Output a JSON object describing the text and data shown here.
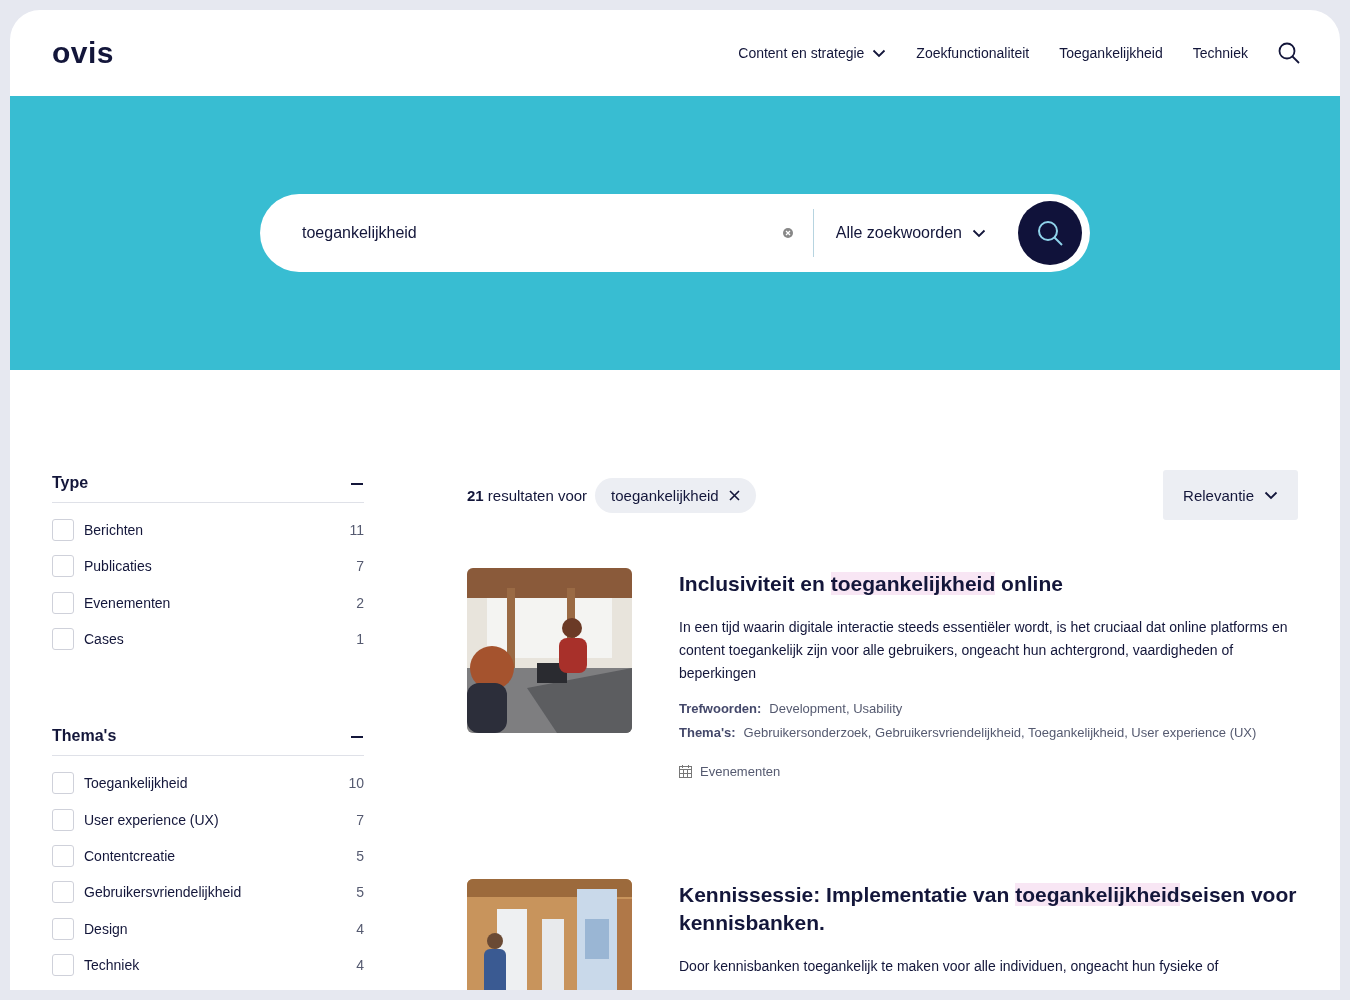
{
  "header": {
    "logo": "ovis",
    "nav": [
      {
        "label": "Content en strategie",
        "kind": "dropdown"
      },
      {
        "label": "Zoekfunctionaliteit",
        "kind": "link"
      },
      {
        "label": "Toegankelijkheid",
        "kind": "link"
      },
      {
        "label": "Techniek",
        "kind": "link"
      }
    ]
  },
  "search": {
    "value": "toegankelijkheid",
    "mode": "Alle zoekwoorden"
  },
  "filters": [
    {
      "title": "Type",
      "expanded": true,
      "options": [
        {
          "label": "Berichten",
          "count": "11",
          "checked": false
        },
        {
          "label": "Publicaties",
          "count": "7",
          "checked": false
        },
        {
          "label": "Evenementen",
          "count": "2",
          "checked": false
        },
        {
          "label": "Cases",
          "count": "1",
          "checked": false
        }
      ]
    },
    {
      "title": "Thema's",
      "expanded": true,
      "options": [
        {
          "label": "Toegankelijkheid",
          "count": "10",
          "checked": false
        },
        {
          "label": "User experience (UX)",
          "count": "7",
          "checked": false
        },
        {
          "label": "Contentcreatie",
          "count": "5",
          "checked": false
        },
        {
          "label": "Gebruikersvriendelijkheid",
          "count": "5",
          "checked": false
        },
        {
          "label": "Design",
          "count": "4",
          "checked": false
        },
        {
          "label": "Techniek",
          "count": "4",
          "checked": false
        }
      ]
    }
  ],
  "results_header": {
    "count": "21",
    "text": "resultaten voor",
    "chip": "toegankelijkheid",
    "sort": "Relevantie"
  },
  "results": [
    {
      "kind": "picture",
      "title_parts": [
        {
          "text": "Inclusiviteit en ",
          "highlighted": false
        },
        {
          "text": "toegankelijkheid",
          "highlighted": true
        },
        {
          "text": " online",
          "highlighted": false
        }
      ],
      "description": "In een tijd waarin digitale interactie steeds essentiëler wordt, is het cruciaal dat online platforms en content toegankelijk zijn voor alle gebruikers, ongeacht hun achtergrond, vaardigheden of beperkingen",
      "meta": [
        {
          "label": "Trefwoorden:",
          "value": "Development, Usability"
        },
        {
          "label": "Thema's:",
          "value": "Gebruikersonderzoek, Gebruikersvriendelijkheid, Toegankelijkheid, User experience (UX)"
        }
      ],
      "type": "Evenementen"
    },
    {
      "kind": "picture",
      "title_parts": [
        {
          "text": "Kennissessie: Implementatie van ",
          "highlighted": false
        },
        {
          "text": "toegankelijkheid",
          "highlighted": true
        },
        {
          "text": "seisen voor kennisbanken.",
          "highlighted": false
        }
      ],
      "description": "Door kennisbanken toegankelijk te maken voor alle individuen, ongeacht hun fysieke of"
    }
  ]
}
